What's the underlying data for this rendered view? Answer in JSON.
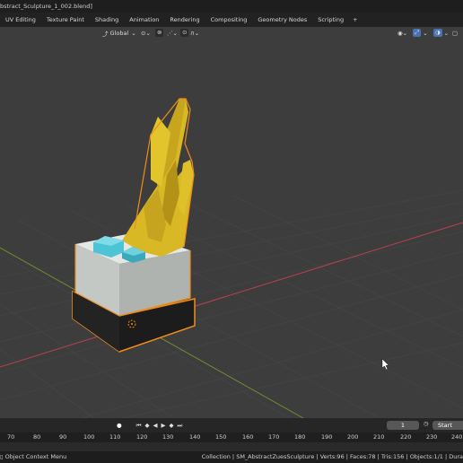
{
  "window": {
    "title": "bstract_Sculpture_1_002.blend]"
  },
  "menus": [
    "UV Editing",
    "Texture Paint",
    "Shading",
    "Animation",
    "Rendering",
    "Compositing",
    "Geometry Nodes",
    "Scripting"
  ],
  "menu_add": "+",
  "viewport_header": {
    "orientation": "Global"
  },
  "timeline": {
    "current_frame": "1",
    "start_label": "Start",
    "ruler_ticks": [
      "70",
      "80",
      "90",
      "100",
      "110",
      "120",
      "130",
      "140",
      "150",
      "160",
      "170",
      "180",
      "190",
      "200",
      "210",
      "220",
      "230",
      "240"
    ]
  },
  "status": {
    "mode": "Object Context Menu",
    "stats": "Collection | SM_AbstractZuesSculpture | Verts:96 | Faces:78 | Tris:156 | Objects:1/1 | Dura"
  },
  "colors": {
    "selection_outline": "#f08c1a",
    "gold": "#d4b424",
    "cube_grey": "#c7cbc7",
    "base_black": "#1c1c1c",
    "crystal": "#48c2d4"
  }
}
